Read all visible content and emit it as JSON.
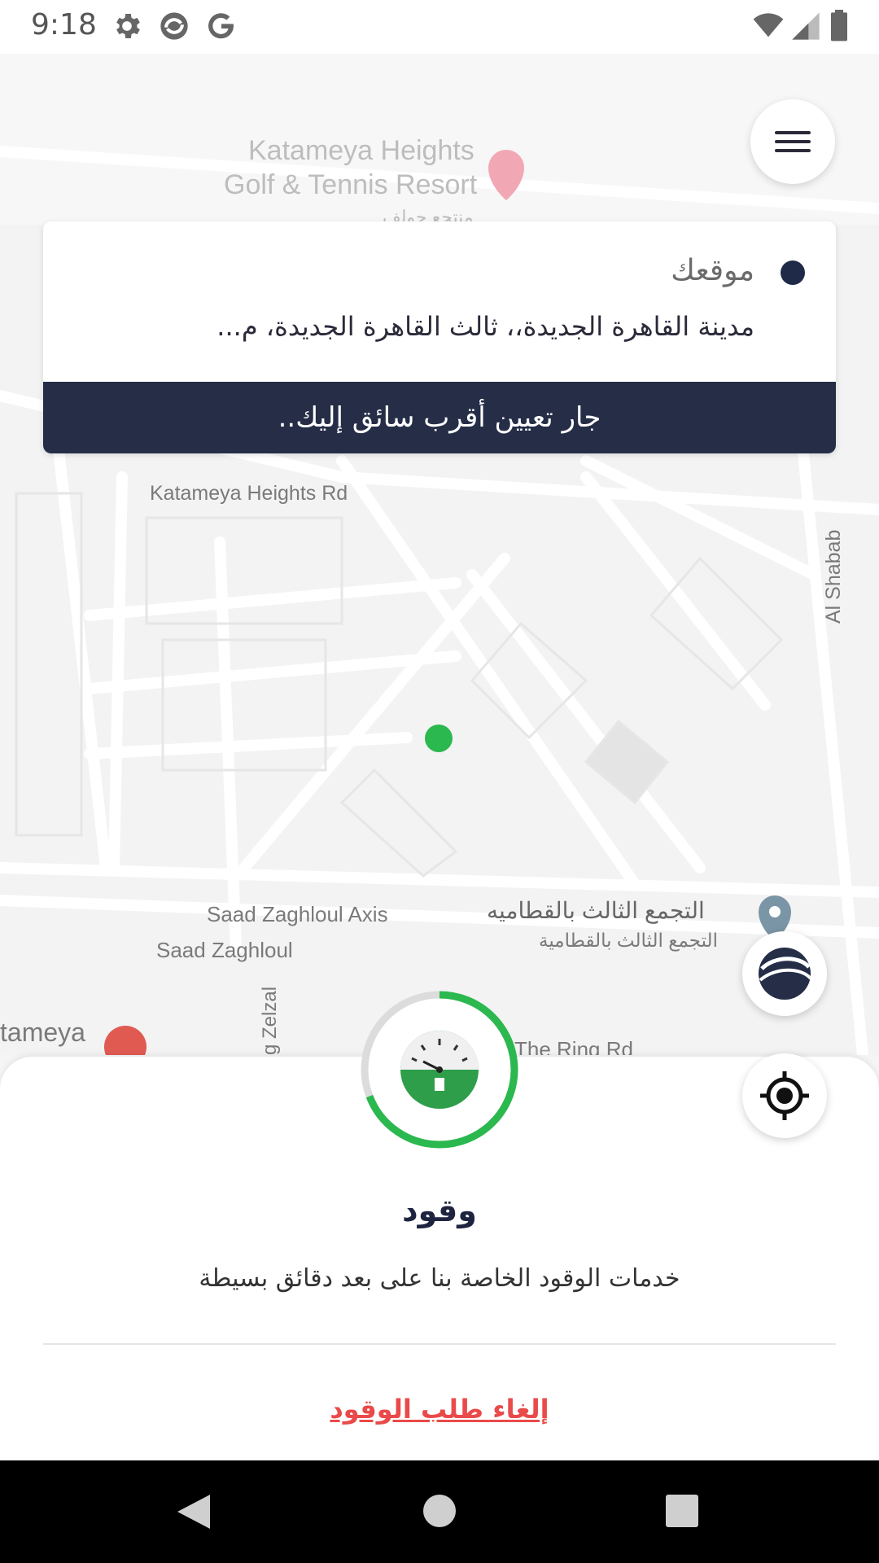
{
  "status_bar": {
    "time": "9:18"
  },
  "map": {
    "labels": {
      "resort_line1": "Katameya Heights",
      "resort_line2": "Golf & Tennis Resort",
      "resort_ar": "منتجع جولف",
      "heights_rd": "Katameya Heights Rd",
      "al_shabab": "Al Shabab",
      "saad_axis": "Saad Zaghloul Axis",
      "saad": "Saad Zaghloul",
      "tagamoa_main": "التجمع الثالث بالقطاميه",
      "tagamoa_sub": "التجمع الثالث بالقطامية",
      "zelzal": "g Zelzal",
      "katameya": "tameya",
      "ring_rd": "The Ring Rd"
    }
  },
  "location_card": {
    "title": "موقعك",
    "address": "مدينة القاهرة الجديدة،، ثالث القاهرة الجديدة، م...",
    "assign_status": "جار تعيين أقرب سائق إليك.."
  },
  "service": {
    "title": "وقود",
    "description": "خدمات الوقود الخاصة بنا على بعد دقائق بسيطة",
    "cancel_label": "إلغاء طلب الوقود"
  },
  "colors": {
    "navy": "#252d47",
    "green": "#2bb84f",
    "cancel_red": "#ea4a4a"
  }
}
